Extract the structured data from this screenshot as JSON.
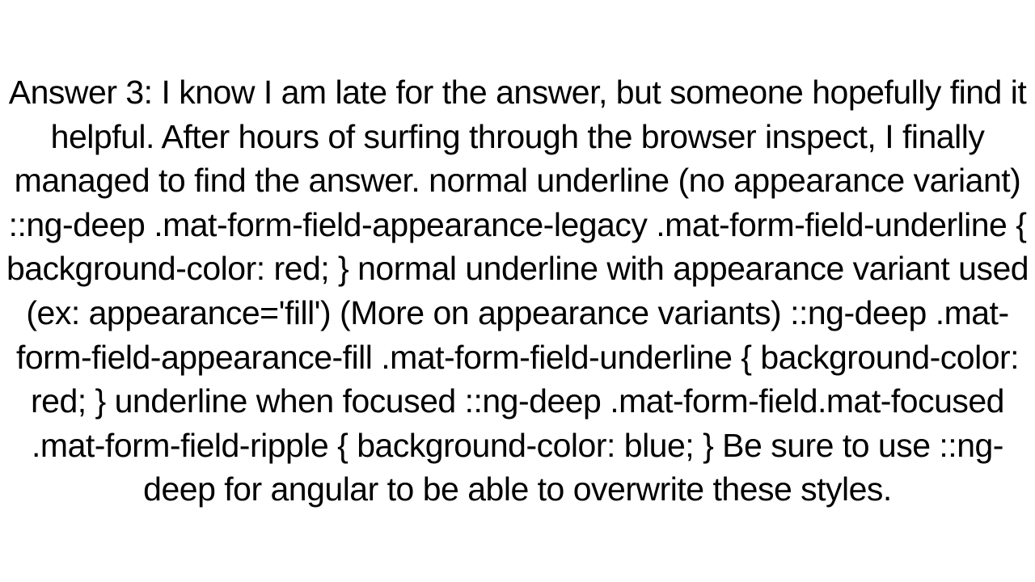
{
  "text": "Answer 3: I know I am late for the answer, but someone hopefully find it helpful. After hours of surfing through the browser inspect, I finally managed to find the answer.   normal underline (no appearance variant)  ::ng-deep .mat-form-field-appearance-legacy .mat-form-field-underline {   background-color: red; }   normal underline with appearance variant used (ex: appearance='fill') (More on appearance variants)  ::ng-deep .mat-form-field-appearance-fill .mat-form-field-underline {   background-color: red; }   underline when focused  ::ng-deep .mat-form-field.mat-focused .mat-form-field-ripple {   background-color: blue; }   Be sure to use ::ng-deep for angular to be able to overwrite these styles."
}
